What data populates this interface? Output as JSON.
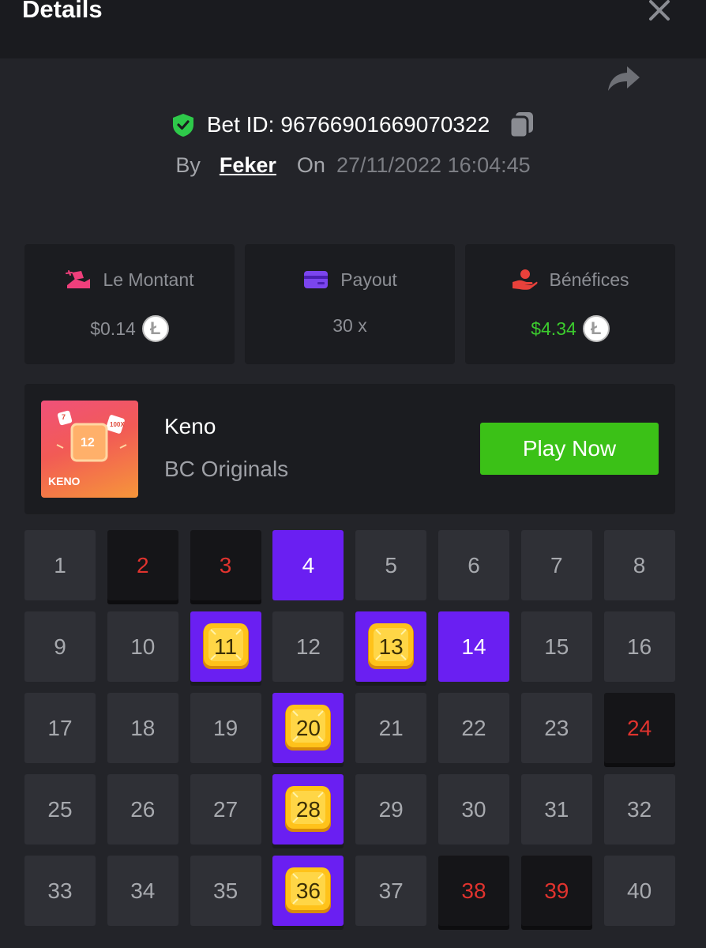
{
  "header": {
    "title": "Details",
    "close_icon": "close-icon"
  },
  "bet": {
    "id_label": "Bet ID:",
    "id_value": "96766901669070322",
    "by_label": "By",
    "user": "Feker",
    "on_label": "On",
    "date": "27/11/2022 16:04:45"
  },
  "stats": [
    {
      "label": "Le Montant",
      "value": "$0.14",
      "icon": "bet-amount-icon",
      "coin": "litecoin-icon"
    },
    {
      "label": "Payout",
      "value": "30 x",
      "icon": "card-icon"
    },
    {
      "label": "Bénéfices",
      "value": "$4.34",
      "icon": "profit-hand-icon",
      "coin": "litecoin-icon"
    }
  ],
  "game": {
    "name": "Keno",
    "provider": "BC Originals",
    "play_label": "Play Now",
    "thumb_number": "12",
    "thumb_text": "KENO",
    "thumb_dice_1": "7",
    "thumb_dice_2": "100X"
  },
  "grid": {
    "cells": [
      {
        "n": "1",
        "s": "normal"
      },
      {
        "n": "2",
        "s": "miss"
      },
      {
        "n": "3",
        "s": "miss"
      },
      {
        "n": "4",
        "s": "pick"
      },
      {
        "n": "5",
        "s": "normal"
      },
      {
        "n": "6",
        "s": "normal"
      },
      {
        "n": "7",
        "s": "normal"
      },
      {
        "n": "8",
        "s": "normal"
      },
      {
        "n": "9",
        "s": "normal"
      },
      {
        "n": "10",
        "s": "normal"
      },
      {
        "n": "11",
        "s": "hit"
      },
      {
        "n": "12",
        "s": "normal"
      },
      {
        "n": "13",
        "s": "hit"
      },
      {
        "n": "14",
        "s": "pick"
      },
      {
        "n": "15",
        "s": "normal"
      },
      {
        "n": "16",
        "s": "normal"
      },
      {
        "n": "17",
        "s": "normal"
      },
      {
        "n": "18",
        "s": "normal"
      },
      {
        "n": "19",
        "s": "normal"
      },
      {
        "n": "20",
        "s": "hit"
      },
      {
        "n": "21",
        "s": "normal"
      },
      {
        "n": "22",
        "s": "normal"
      },
      {
        "n": "23",
        "s": "normal"
      },
      {
        "n": "24",
        "s": "miss"
      },
      {
        "n": "25",
        "s": "normal"
      },
      {
        "n": "26",
        "s": "normal"
      },
      {
        "n": "27",
        "s": "normal"
      },
      {
        "n": "28",
        "s": "hit"
      },
      {
        "n": "29",
        "s": "normal"
      },
      {
        "n": "30",
        "s": "normal"
      },
      {
        "n": "31",
        "s": "normal"
      },
      {
        "n": "32",
        "s": "normal"
      },
      {
        "n": "33",
        "s": "normal"
      },
      {
        "n": "34",
        "s": "normal"
      },
      {
        "n": "35",
        "s": "normal"
      },
      {
        "n": "36",
        "s": "hit"
      },
      {
        "n": "37",
        "s": "normal"
      },
      {
        "n": "38",
        "s": "miss"
      },
      {
        "n": "39",
        "s": "miss"
      },
      {
        "n": "40",
        "s": "normal"
      }
    ]
  },
  "colors": {
    "background": "#232429",
    "panel": "#1b1c20",
    "picked": "#6a1ff2",
    "miss_text": "#e0332e",
    "profit": "#3ccb2e",
    "play_button": "#3bc117",
    "gem": "#ffc21a"
  }
}
